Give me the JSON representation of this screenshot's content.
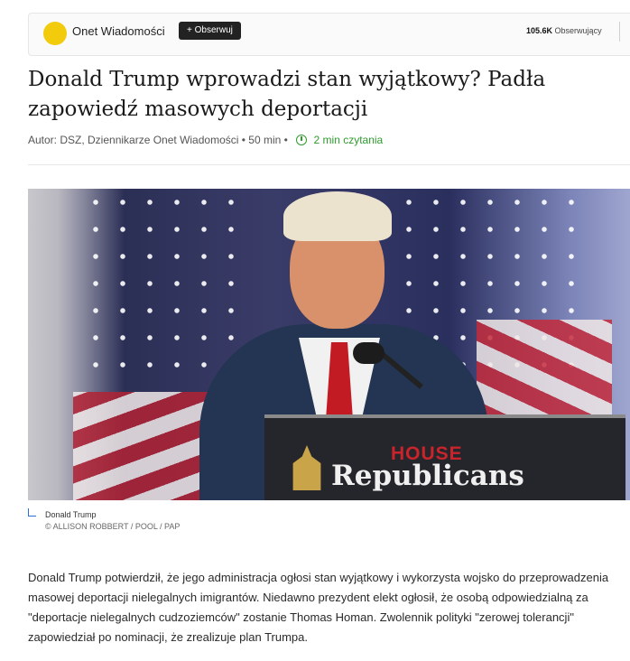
{
  "publisher": {
    "name": "Onet Wiadomości",
    "follow_label": "+ Obserwuj",
    "followers_count": "105.6K",
    "followers_label": "Obserwujący",
    "logo_color": "#f2cc0c"
  },
  "article": {
    "headline": "Donald Trump wprowadzi stan wyjątkowy? Padła zapowiedź masowych deportacji",
    "byline_prefix": "Autor: DSZ, Dziennikarze Onet Wiadomości • 50 min •",
    "read_time": "2 min czytania",
    "lead": "Donald Trump potwierdził, że jego administracja ogłosi stan wyjątkowy i wykorzysta wojsko do przeprowadzenia masowej deportacji nielegalnych imigrantów. Niedawno prezydent elekt ogłosił, że osobą odpowiedzialną za \"deportacje nielegalnych cudzoziemców\" zostanie Thomas Homan. Zwolennik polityki \"zerowej tolerancji\" zapowiedział po nominacji, że zrealizuje plan Trumpa."
  },
  "photo": {
    "podium_house": "HOUSE",
    "podium_republicans": "Republicans",
    "caption": "Donald Trump",
    "credit": "© ALLISON ROBBERT / POOL / PAP"
  },
  "colors": {
    "read_time": "#2e9b2e",
    "follow_button": "#222222",
    "caption_accent": "#2b6fd6"
  }
}
